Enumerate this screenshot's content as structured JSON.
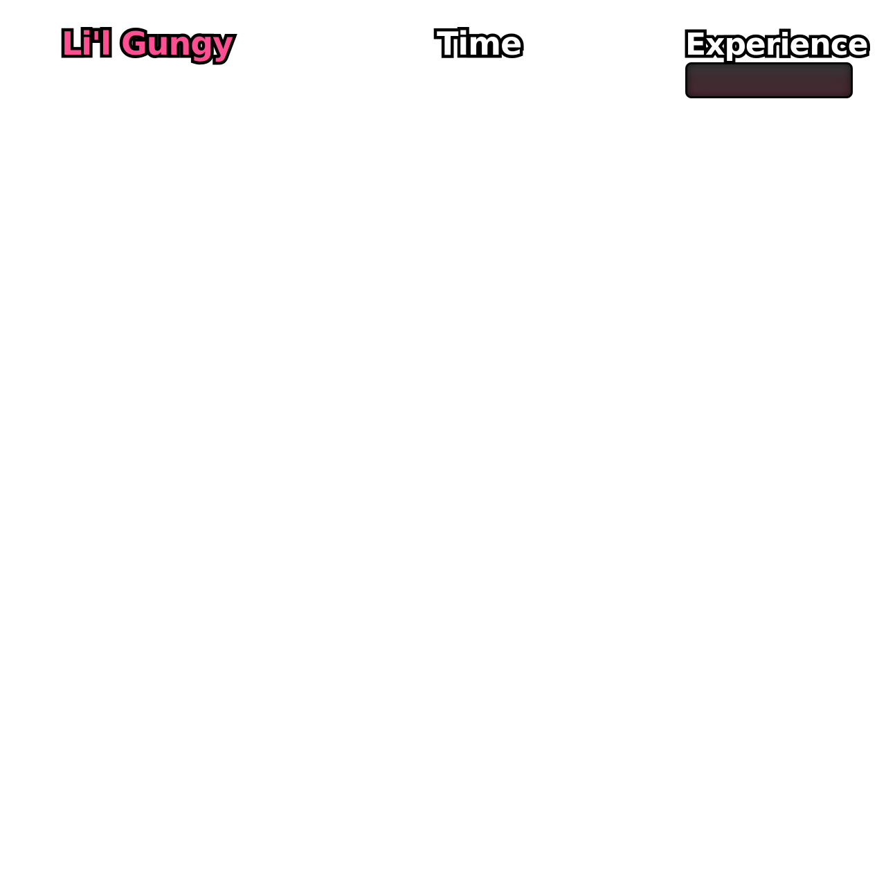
{
  "hud": {
    "character_name": "Li'l Gungy",
    "time_label": "Time",
    "experience_label": "Experience",
    "experience_progress": 0,
    "colors": {
      "name_pink": "#ff4f93",
      "label_white": "#ffffff",
      "outline": "#000000",
      "bar_background": "#3e2b30"
    }
  }
}
